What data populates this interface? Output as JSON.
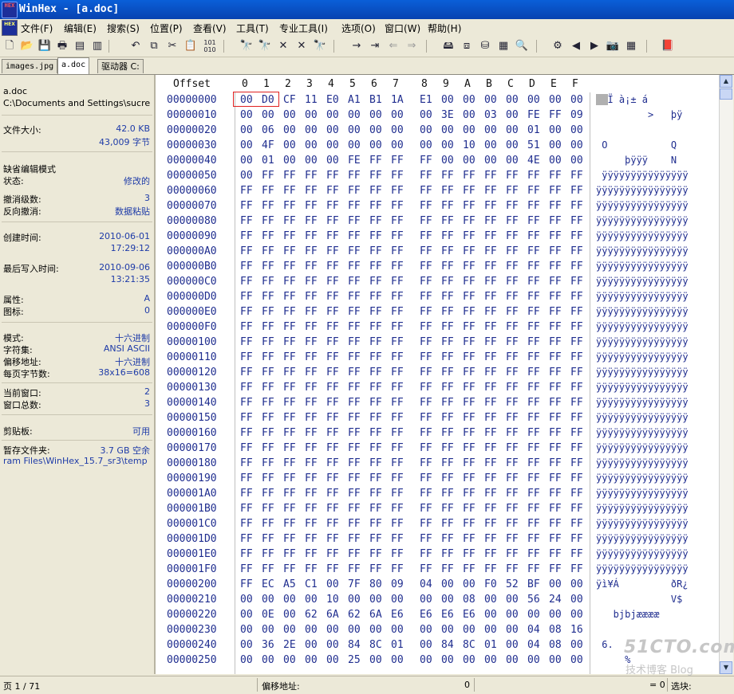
{
  "window": {
    "app_icon_label": "HEX",
    "title": "WinHex - [a.doc]"
  },
  "menu": {
    "doc_icon_label": "HEX",
    "items": [
      "文件(F)",
      "编辑(E)",
      "搜索(S)",
      "位置(P)",
      "查看(V)",
      "工具(T)",
      "专业工具(I)",
      "选项(O)",
      "窗口(W)",
      "帮助(H)"
    ]
  },
  "toolbar": {
    "icons": [
      "new-file-icon",
      "open-icon",
      "save-icon",
      "print-icon",
      "properties-icon",
      "undo-icon",
      "copy-icon",
      "cut-icon",
      "paste-icon",
      "binary-icon",
      "find-icon",
      "find-hex-icon",
      "replace-icon",
      "replace-hex-icon",
      "find-text-icon",
      "goto-offset-icon",
      "goto-icon",
      "back-icon",
      "forward-icon",
      "open-disk-icon",
      "clone-disk-icon",
      "ram-icon",
      "calculator-icon",
      "search-glass-icon",
      "hash-icon",
      "prev-icon",
      "next-icon",
      "camera-icon",
      "grid-icon",
      "book-icon"
    ]
  },
  "tabs": [
    {
      "label": "images.jpg",
      "active": false
    },
    {
      "label": "a.doc",
      "active": true
    },
    {
      "label": "驱动器 C:",
      "active": false
    }
  ],
  "info_panel": {
    "filename": "a.doc",
    "path": "C:\\Documents and Settings\\sucre",
    "file_size_label": "文件大小:",
    "file_size_kb": "42.0 KB",
    "file_size_bytes": "43,009 字节",
    "edit_mode_label": "缺省编辑模式",
    "state_label": "状态:",
    "state_value": "修改的",
    "undo_level_label": "撤消级数:",
    "undo_level_value": "3",
    "reverse_undo_label": "反向撤消:",
    "reverse_undo_value": "数据粘贴",
    "created_label": "创建时间:",
    "created_date": "2010-06-01",
    "created_time": "17:29:12",
    "modified_label": "最后写入时间:",
    "modified_date": "2010-09-06",
    "modified_time": "13:21:35",
    "attributes_label": "属性:",
    "attributes_value": "A",
    "icons_label": "图标:",
    "icons_value": "0",
    "mode_label": "模式:",
    "mode_value": "十六进制",
    "charset_label": "字符集:",
    "charset_value": "ANSI ASCII",
    "offset_label": "偏移地址:",
    "offset_value": "十六进制",
    "bytes_per_page_label": "每页字节数:",
    "bytes_per_page_value": "38x16=608",
    "current_window_label": "当前窗口:",
    "current_window_value": "2",
    "total_windows_label": "窗口总数:",
    "total_windows_value": "3",
    "clipboard_label": "剪贴板:",
    "clipboard_value": "可用",
    "temp_folder_label": "暂存文件夹:",
    "temp_folder_value": "3.7 GB 空余",
    "temp_folder_path": "ram Files\\WinHex_15.7_sr3\\temp"
  },
  "hex_view": {
    "offset_header": "Offset",
    "column_headers": [
      "0",
      "1",
      "2",
      "3",
      "4",
      "5",
      "6",
      "7",
      "8",
      "9",
      "A",
      "B",
      "C",
      "D",
      "E",
      "F"
    ],
    "rows": [
      {
        "offset": "00000000",
        "bytes": [
          "00",
          "D0",
          "CF",
          "11",
          "E0",
          "A1",
          "B1",
          "1A",
          "E1",
          "00",
          "00",
          "00",
          "00",
          "00",
          "00",
          "00"
        ],
        "ascii": " ÐÏ à¡± á"
      },
      {
        "offset": "00000010",
        "bytes": [
          "00",
          "00",
          "00",
          "00",
          "00",
          "00",
          "00",
          "00",
          "00",
          "3E",
          "00",
          "03",
          "00",
          "FE",
          "FF",
          "09"
        ],
        "ascii": "         >   þÿ"
      },
      {
        "offset": "00000020",
        "bytes": [
          "00",
          "06",
          "00",
          "00",
          "00",
          "00",
          "00",
          "00",
          "00",
          "00",
          "00",
          "00",
          "00",
          "01",
          "00",
          "00"
        ],
        "ascii": ""
      },
      {
        "offset": "00000030",
        "bytes": [
          "00",
          "4F",
          "00",
          "00",
          "00",
          "00",
          "00",
          "00",
          "00",
          "00",
          "10",
          "00",
          "00",
          "51",
          "00",
          "00"
        ],
        "ascii": " O           Q"
      },
      {
        "offset": "00000040",
        "bytes": [
          "00",
          "01",
          "00",
          "00",
          "00",
          "FE",
          "FF",
          "FF",
          "FF",
          "00",
          "00",
          "00",
          "00",
          "4E",
          "00",
          "00"
        ],
        "ascii": "     þÿÿÿ    N"
      },
      {
        "offset": "00000050",
        "bytes": [
          "00",
          "FF",
          "FF",
          "FF",
          "FF",
          "FF",
          "FF",
          "FF",
          "FF",
          "FF",
          "FF",
          "FF",
          "FF",
          "FF",
          "FF",
          "FF"
        ],
        "ascii": " ÿÿÿÿÿÿÿÿÿÿÿÿÿÿÿ"
      },
      {
        "offset": "00000060",
        "bytes": [
          "FF",
          "FF",
          "FF",
          "FF",
          "FF",
          "FF",
          "FF",
          "FF",
          "FF",
          "FF",
          "FF",
          "FF",
          "FF",
          "FF",
          "FF",
          "FF"
        ],
        "ascii": "ÿÿÿÿÿÿÿÿÿÿÿÿÿÿÿÿ"
      },
      {
        "offset": "00000070",
        "bytes": [
          "FF",
          "FF",
          "FF",
          "FF",
          "FF",
          "FF",
          "FF",
          "FF",
          "FF",
          "FF",
          "FF",
          "FF",
          "FF",
          "FF",
          "FF",
          "FF"
        ],
        "ascii": "ÿÿÿÿÿÿÿÿÿÿÿÿÿÿÿÿ"
      },
      {
        "offset": "00000080",
        "bytes": [
          "FF",
          "FF",
          "FF",
          "FF",
          "FF",
          "FF",
          "FF",
          "FF",
          "FF",
          "FF",
          "FF",
          "FF",
          "FF",
          "FF",
          "FF",
          "FF"
        ],
        "ascii": "ÿÿÿÿÿÿÿÿÿÿÿÿÿÿÿÿ"
      },
      {
        "offset": "00000090",
        "bytes": [
          "FF",
          "FF",
          "FF",
          "FF",
          "FF",
          "FF",
          "FF",
          "FF",
          "FF",
          "FF",
          "FF",
          "FF",
          "FF",
          "FF",
          "FF",
          "FF"
        ],
        "ascii": "ÿÿÿÿÿÿÿÿÿÿÿÿÿÿÿÿ"
      },
      {
        "offset": "000000A0",
        "bytes": [
          "FF",
          "FF",
          "FF",
          "FF",
          "FF",
          "FF",
          "FF",
          "FF",
          "FF",
          "FF",
          "FF",
          "FF",
          "FF",
          "FF",
          "FF",
          "FF"
        ],
        "ascii": "ÿÿÿÿÿÿÿÿÿÿÿÿÿÿÿÿ"
      },
      {
        "offset": "000000B0",
        "bytes": [
          "FF",
          "FF",
          "FF",
          "FF",
          "FF",
          "FF",
          "FF",
          "FF",
          "FF",
          "FF",
          "FF",
          "FF",
          "FF",
          "FF",
          "FF",
          "FF"
        ],
        "ascii": "ÿÿÿÿÿÿÿÿÿÿÿÿÿÿÿÿ"
      },
      {
        "offset": "000000C0",
        "bytes": [
          "FF",
          "FF",
          "FF",
          "FF",
          "FF",
          "FF",
          "FF",
          "FF",
          "FF",
          "FF",
          "FF",
          "FF",
          "FF",
          "FF",
          "FF",
          "FF"
        ],
        "ascii": "ÿÿÿÿÿÿÿÿÿÿÿÿÿÿÿÿ"
      },
      {
        "offset": "000000D0",
        "bytes": [
          "FF",
          "FF",
          "FF",
          "FF",
          "FF",
          "FF",
          "FF",
          "FF",
          "FF",
          "FF",
          "FF",
          "FF",
          "FF",
          "FF",
          "FF",
          "FF"
        ],
        "ascii": "ÿÿÿÿÿÿÿÿÿÿÿÿÿÿÿÿ"
      },
      {
        "offset": "000000E0",
        "bytes": [
          "FF",
          "FF",
          "FF",
          "FF",
          "FF",
          "FF",
          "FF",
          "FF",
          "FF",
          "FF",
          "FF",
          "FF",
          "FF",
          "FF",
          "FF",
          "FF"
        ],
        "ascii": "ÿÿÿÿÿÿÿÿÿÿÿÿÿÿÿÿ"
      },
      {
        "offset": "000000F0",
        "bytes": [
          "FF",
          "FF",
          "FF",
          "FF",
          "FF",
          "FF",
          "FF",
          "FF",
          "FF",
          "FF",
          "FF",
          "FF",
          "FF",
          "FF",
          "FF",
          "FF"
        ],
        "ascii": "ÿÿÿÿÿÿÿÿÿÿÿÿÿÿÿÿ"
      },
      {
        "offset": "00000100",
        "bytes": [
          "FF",
          "FF",
          "FF",
          "FF",
          "FF",
          "FF",
          "FF",
          "FF",
          "FF",
          "FF",
          "FF",
          "FF",
          "FF",
          "FF",
          "FF",
          "FF"
        ],
        "ascii": "ÿÿÿÿÿÿÿÿÿÿÿÿÿÿÿÿ"
      },
      {
        "offset": "00000110",
        "bytes": [
          "FF",
          "FF",
          "FF",
          "FF",
          "FF",
          "FF",
          "FF",
          "FF",
          "FF",
          "FF",
          "FF",
          "FF",
          "FF",
          "FF",
          "FF",
          "FF"
        ],
        "ascii": "ÿÿÿÿÿÿÿÿÿÿÿÿÿÿÿÿ"
      },
      {
        "offset": "00000120",
        "bytes": [
          "FF",
          "FF",
          "FF",
          "FF",
          "FF",
          "FF",
          "FF",
          "FF",
          "FF",
          "FF",
          "FF",
          "FF",
          "FF",
          "FF",
          "FF",
          "FF"
        ],
        "ascii": "ÿÿÿÿÿÿÿÿÿÿÿÿÿÿÿÿ"
      },
      {
        "offset": "00000130",
        "bytes": [
          "FF",
          "FF",
          "FF",
          "FF",
          "FF",
          "FF",
          "FF",
          "FF",
          "FF",
          "FF",
          "FF",
          "FF",
          "FF",
          "FF",
          "FF",
          "FF"
        ],
        "ascii": "ÿÿÿÿÿÿÿÿÿÿÿÿÿÿÿÿ"
      },
      {
        "offset": "00000140",
        "bytes": [
          "FF",
          "FF",
          "FF",
          "FF",
          "FF",
          "FF",
          "FF",
          "FF",
          "FF",
          "FF",
          "FF",
          "FF",
          "FF",
          "FF",
          "FF",
          "FF"
        ],
        "ascii": "ÿÿÿÿÿÿÿÿÿÿÿÿÿÿÿÿ"
      },
      {
        "offset": "00000150",
        "bytes": [
          "FF",
          "FF",
          "FF",
          "FF",
          "FF",
          "FF",
          "FF",
          "FF",
          "FF",
          "FF",
          "FF",
          "FF",
          "FF",
          "FF",
          "FF",
          "FF"
        ],
        "ascii": "ÿÿÿÿÿÿÿÿÿÿÿÿÿÿÿÿ"
      },
      {
        "offset": "00000160",
        "bytes": [
          "FF",
          "FF",
          "FF",
          "FF",
          "FF",
          "FF",
          "FF",
          "FF",
          "FF",
          "FF",
          "FF",
          "FF",
          "FF",
          "FF",
          "FF",
          "FF"
        ],
        "ascii": "ÿÿÿÿÿÿÿÿÿÿÿÿÿÿÿÿ"
      },
      {
        "offset": "00000170",
        "bytes": [
          "FF",
          "FF",
          "FF",
          "FF",
          "FF",
          "FF",
          "FF",
          "FF",
          "FF",
          "FF",
          "FF",
          "FF",
          "FF",
          "FF",
          "FF",
          "FF"
        ],
        "ascii": "ÿÿÿÿÿÿÿÿÿÿÿÿÿÿÿÿ"
      },
      {
        "offset": "00000180",
        "bytes": [
          "FF",
          "FF",
          "FF",
          "FF",
          "FF",
          "FF",
          "FF",
          "FF",
          "FF",
          "FF",
          "FF",
          "FF",
          "FF",
          "FF",
          "FF",
          "FF"
        ],
        "ascii": "ÿÿÿÿÿÿÿÿÿÿÿÿÿÿÿÿ"
      },
      {
        "offset": "00000190",
        "bytes": [
          "FF",
          "FF",
          "FF",
          "FF",
          "FF",
          "FF",
          "FF",
          "FF",
          "FF",
          "FF",
          "FF",
          "FF",
          "FF",
          "FF",
          "FF",
          "FF"
        ],
        "ascii": "ÿÿÿÿÿÿÿÿÿÿÿÿÿÿÿÿ"
      },
      {
        "offset": "000001A0",
        "bytes": [
          "FF",
          "FF",
          "FF",
          "FF",
          "FF",
          "FF",
          "FF",
          "FF",
          "FF",
          "FF",
          "FF",
          "FF",
          "FF",
          "FF",
          "FF",
          "FF"
        ],
        "ascii": "ÿÿÿÿÿÿÿÿÿÿÿÿÿÿÿÿ"
      },
      {
        "offset": "000001B0",
        "bytes": [
          "FF",
          "FF",
          "FF",
          "FF",
          "FF",
          "FF",
          "FF",
          "FF",
          "FF",
          "FF",
          "FF",
          "FF",
          "FF",
          "FF",
          "FF",
          "FF"
        ],
        "ascii": "ÿÿÿÿÿÿÿÿÿÿÿÿÿÿÿÿ"
      },
      {
        "offset": "000001C0",
        "bytes": [
          "FF",
          "FF",
          "FF",
          "FF",
          "FF",
          "FF",
          "FF",
          "FF",
          "FF",
          "FF",
          "FF",
          "FF",
          "FF",
          "FF",
          "FF",
          "FF"
        ],
        "ascii": "ÿÿÿÿÿÿÿÿÿÿÿÿÿÿÿÿ"
      },
      {
        "offset": "000001D0",
        "bytes": [
          "FF",
          "FF",
          "FF",
          "FF",
          "FF",
          "FF",
          "FF",
          "FF",
          "FF",
          "FF",
          "FF",
          "FF",
          "FF",
          "FF",
          "FF",
          "FF"
        ],
        "ascii": "ÿÿÿÿÿÿÿÿÿÿÿÿÿÿÿÿ"
      },
      {
        "offset": "000001E0",
        "bytes": [
          "FF",
          "FF",
          "FF",
          "FF",
          "FF",
          "FF",
          "FF",
          "FF",
          "FF",
          "FF",
          "FF",
          "FF",
          "FF",
          "FF",
          "FF",
          "FF"
        ],
        "ascii": "ÿÿÿÿÿÿÿÿÿÿÿÿÿÿÿÿ"
      },
      {
        "offset": "000001F0",
        "bytes": [
          "FF",
          "FF",
          "FF",
          "FF",
          "FF",
          "FF",
          "FF",
          "FF",
          "FF",
          "FF",
          "FF",
          "FF",
          "FF",
          "FF",
          "FF",
          "FF"
        ],
        "ascii": "ÿÿÿÿÿÿÿÿÿÿÿÿÿÿÿÿ"
      },
      {
        "offset": "00000200",
        "bytes": [
          "FF",
          "EC",
          "A5",
          "C1",
          "00",
          "7F",
          "80",
          "09",
          "04",
          "00",
          "00",
          "F0",
          "52",
          "BF",
          "00",
          "00"
        ],
        "ascii": "ÿì¥Á         ðR¿"
      },
      {
        "offset": "00000210",
        "bytes": [
          "00",
          "00",
          "00",
          "00",
          "10",
          "00",
          "00",
          "00",
          "00",
          "00",
          "08",
          "00",
          "00",
          "56",
          "24",
          "00"
        ],
        "ascii": "             V$"
      },
      {
        "offset": "00000220",
        "bytes": [
          "00",
          "0E",
          "00",
          "62",
          "6A",
          "62",
          "6A",
          "E6",
          "E6",
          "E6",
          "E6",
          "00",
          "00",
          "00",
          "00",
          "00"
        ],
        "ascii": "   bjbjææææ"
      },
      {
        "offset": "00000230",
        "bytes": [
          "00",
          "00",
          "00",
          "00",
          "00",
          "00",
          "00",
          "00",
          "00",
          "00",
          "00",
          "00",
          "00",
          "04",
          "08",
          "16"
        ],
        "ascii": ""
      },
      {
        "offset": "00000240",
        "bytes": [
          "00",
          "36",
          "2E",
          "00",
          "00",
          "84",
          "8C",
          "01",
          "00",
          "84",
          "8C",
          "01",
          "00",
          "04",
          "08",
          "00"
        ],
        "ascii": " 6."
      },
      {
        "offset": "00000250",
        "bytes": [
          "00",
          "00",
          "00",
          "00",
          "00",
          "25",
          "00",
          "00",
          "00",
          "00",
          "00",
          "00",
          "00",
          "00",
          "00",
          "00"
        ],
        "ascii": "     %"
      }
    ]
  },
  "status_bar": {
    "page": "页 1 / 71",
    "offset_label": "偏移地址:",
    "offset_value": "0",
    "value_text": "= 0",
    "selection_label": "选块:"
  },
  "watermark": {
    "main": "51CTO.com",
    "sub": "技术博客   Blog"
  },
  "colors": {
    "title_bar": "#0842b0",
    "hex_text": "#1f2d8f",
    "info_value": "#1e3ba8",
    "selection_border": "#e02020",
    "panel_bg": "#ECE9D8"
  }
}
